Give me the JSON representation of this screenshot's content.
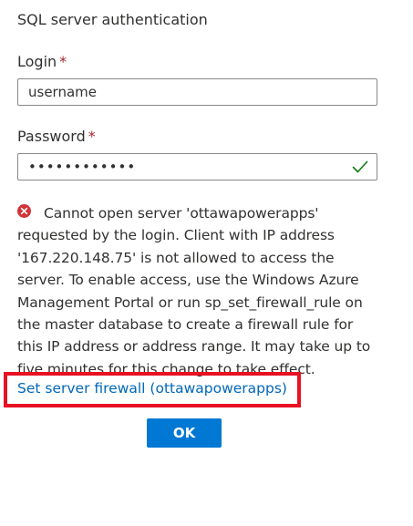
{
  "auth": {
    "title": "SQL server authentication"
  },
  "login": {
    "label": "Login",
    "required_marker": "*",
    "value": "username"
  },
  "password": {
    "label": "Password",
    "required_marker": "*",
    "value": "••••••••••••",
    "valid_icon": "checkmark-icon"
  },
  "error": {
    "icon": "error-circle-icon",
    "message": "Cannot open server 'ottawapowerapps' requested by the login. Client with IP address '167.220.148.75' is not allowed to access the server. To enable access, use the Windows Azure Management Portal or run sp_set_firewall_rule on the master database to create a firewall rule for this IP address or address range. It may take up to five minutes for this change to take effect."
  },
  "firewall_link": {
    "label": "Set server firewall (ottawapowerapps)"
  },
  "ok_button": {
    "label": "OK"
  },
  "colors": {
    "accent": "#0078d4",
    "link": "#0067b8",
    "error": "#d13438",
    "required": "#a4262c",
    "highlight_box": "#e81123",
    "valid": "#107c10"
  }
}
